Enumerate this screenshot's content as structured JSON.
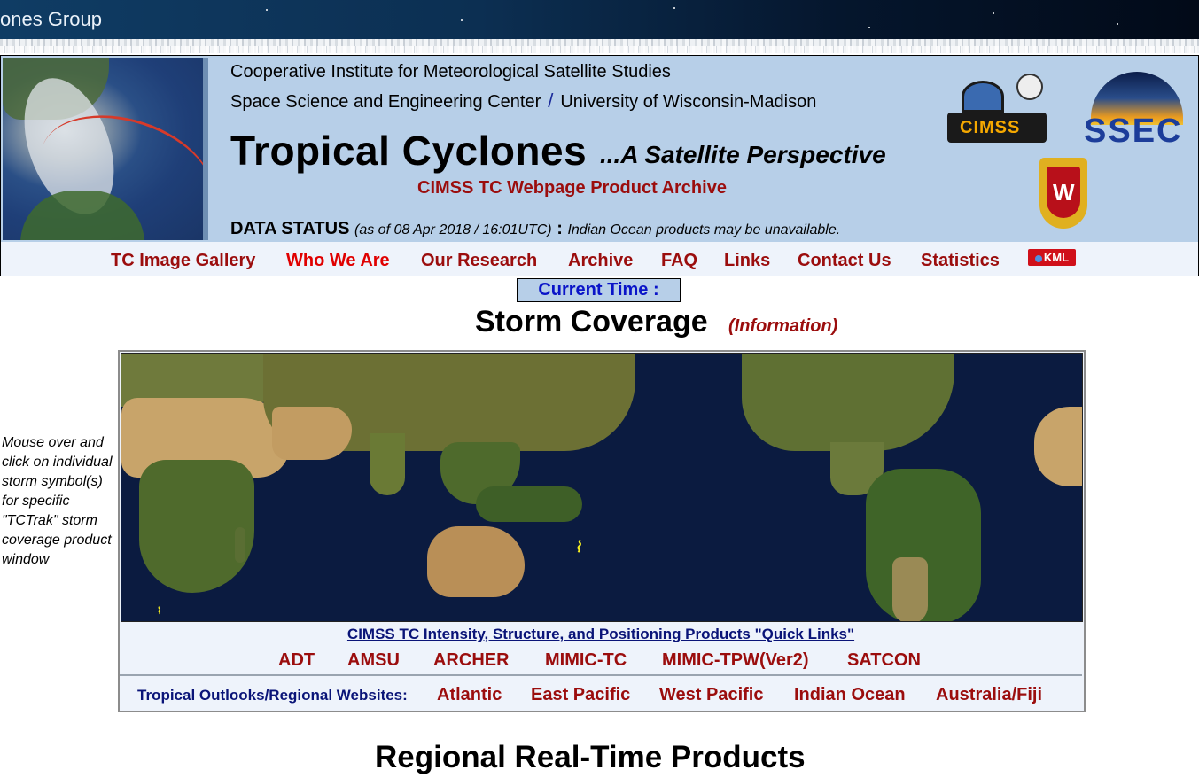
{
  "top_strip": {
    "title": "ones Group"
  },
  "header": {
    "org_line": "Cooperative Institute for Meteorological Satellite Studies",
    "center": "Space Science and Engineering Center",
    "separator": "/",
    "university": "University of Wisconsin-Madison",
    "title": "Tropical Cyclones",
    "subtitle": "...A Satellite Perspective",
    "archive_link": "CIMSS TC Webpage Product Archive",
    "status_label": "DATA STATUS",
    "status_date": "(as of 08 Apr 2018 / 16:01UTC)",
    "status_colon": ":",
    "status_message": "Indian Ocean products may be unavailable.",
    "logos": {
      "cimss": "CIMSS",
      "ssec": "SSEC",
      "uw": "W"
    }
  },
  "nav": {
    "items": [
      "TC Image Gallery",
      "Who We Are",
      "Our Research",
      "Archive",
      "FAQ",
      "Links",
      "Contact Us",
      "Statistics"
    ],
    "active_color": "#e00000",
    "kml_label": "KML"
  },
  "current_time": {
    "label": "Current Time :"
  },
  "storm_coverage": {
    "title": "Storm Coverage",
    "info_link": "(Information)",
    "side_note": "Mouse over and click on individual storm symbol(s) for specific \"TCTrak\" storm coverage product window"
  },
  "quick_links": {
    "title": "CIMSS TC Intensity, Structure, and Positioning Products \"Quick Links\"",
    "items": [
      "ADT",
      "AMSU",
      "ARCHER",
      "MIMIC-TC",
      "MIMIC-TPW(Ver2)",
      "SATCON"
    ]
  },
  "regional_websites": {
    "label": "Tropical Outlooks/Regional Websites:",
    "items": [
      "Atlantic",
      "East Pacific",
      "West Pacific",
      "Indian Ocean",
      "Australia/Fiji"
    ]
  },
  "regional_products": {
    "title": "Regional Real-Time Products"
  },
  "colors": {
    "link_red": "#9b0d0d",
    "header_blue": "#b7cfe8",
    "nav_bg": "#eef3fb",
    "dark_navy": "#0a1478"
  }
}
